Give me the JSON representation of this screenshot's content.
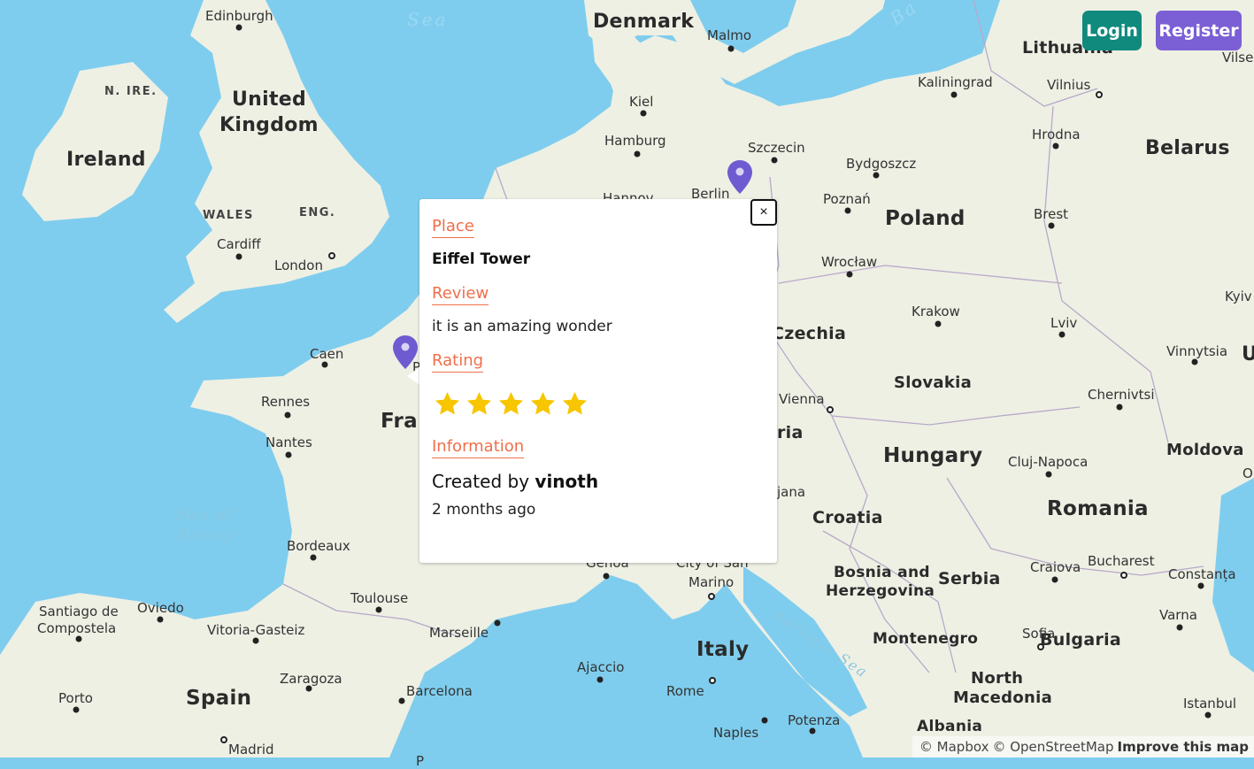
{
  "map": {
    "countries": [
      "Denmark",
      "Lithuania",
      "Belarus",
      "Ireland",
      "United",
      "Kingdom",
      "Poland",
      "Czechia",
      "Slovakia",
      "Hungary",
      "Romania",
      "Moldova",
      "Croatia",
      "Bosnia and",
      "Herzegovina",
      "Serbia",
      "Montenegro",
      "Bulgaria",
      "North",
      "Macedonia",
      "Albania",
      "Italy",
      "Spain",
      "Fra",
      "ria",
      "U"
    ],
    "regions": [
      "N. IRE.",
      "WALES",
      "ENG."
    ],
    "seas": [
      "Sea",
      "Bay of",
      "Biscay",
      "Adriatic Sea",
      "Ba"
    ],
    "cities": [
      "Edinburgh",
      "Malmo",
      "Kiel",
      "Hamburg",
      "Szczecin",
      "Kaliningrad",
      "Vilnius",
      "Hrodna",
      "Bydgoszcz",
      "Poznań",
      "Berlin",
      "Hannov",
      "Cardiff",
      "London",
      "Caen",
      "Rennes",
      "Nantes",
      "Bordeaux",
      "Toulouse",
      "Marseille",
      "Barcelona",
      "Zaragoza",
      "Vitoria-Gasteiz",
      "Oviedo",
      "Santiago de",
      "Compostela",
      "Porto",
      "Madrid",
      "Wrocław",
      "Krakow",
      "Brest",
      "Lviv",
      "Vinnytsia",
      "Chernivtsi",
      "Kyiv",
      "Vilse",
      "Vienna",
      "Cluj-Napoca",
      "Craiova",
      "Bucharest",
      "Constanța",
      "Varna",
      "Sofia",
      "Istanbul",
      "Genoa",
      "City of San",
      "Marino",
      "Ajaccio",
      "Rome",
      "Naples",
      "Potenza",
      "jana",
      "O",
      "Pa",
      "P"
    ]
  },
  "header": {
    "login_label": "Login",
    "register_label": "Register"
  },
  "popup": {
    "place_label": "Place",
    "place_value": "Eiffel Tower",
    "review_label": "Review",
    "review_value": "it is an amazing wonder",
    "rating_label": "Rating",
    "rating": 5,
    "rating_max": 5,
    "information_label": "Information",
    "created_prefix": "Created by",
    "created_user": "vinoth",
    "created_time": "2 months ago",
    "close_label": "×"
  },
  "markers": [
    {
      "name": "paris-marker",
      "color": "#6e5bd1"
    },
    {
      "name": "berlin-marker",
      "color": "#6e5bd1"
    }
  ],
  "attribution": {
    "mapbox": "© Mapbox",
    "osm": "© OpenStreetMap",
    "improve": "Improve this map"
  },
  "colors": {
    "water": "#7fcdee",
    "land": "#eef0e4",
    "login": "#0f8a7d",
    "register": "#7b5fd4",
    "accent": "#ef6f4a",
    "star": "#f7c600"
  }
}
